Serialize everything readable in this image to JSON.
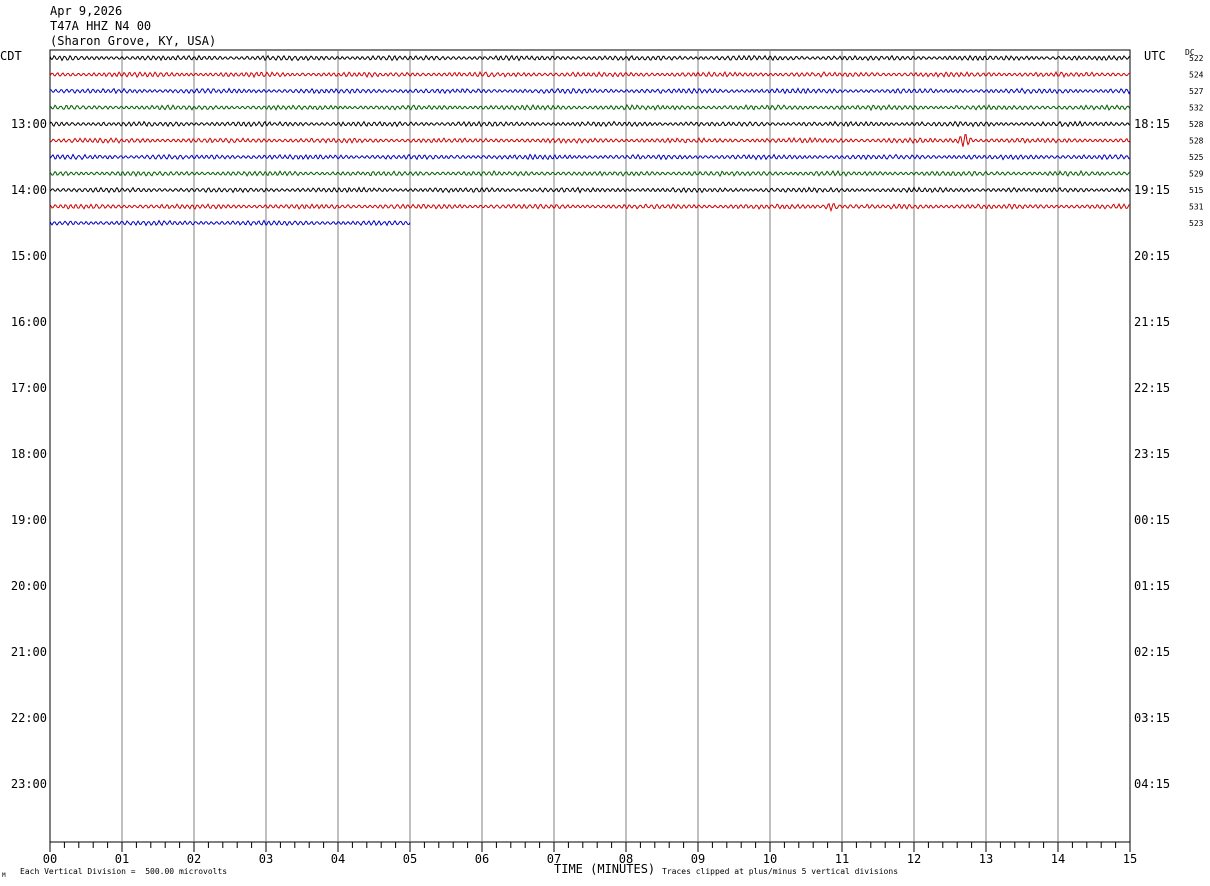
{
  "header": {
    "date": "Apr 9,2026",
    "station": "T47A HHZ N4 00",
    "location": "(Sharon Grove, KY, USA)"
  },
  "timezones": {
    "left": "CDT",
    "right": "UTC",
    "dc": "DC"
  },
  "footer": {
    "division": "Each Vertical Division =  500.00 microvolts",
    "xlabel": "TIME (MINUTES)",
    "clip": "Traces clipped at plus/minus 5 vertical divisions",
    "mark": "M"
  },
  "colors": {
    "cycle": [
      "#000000",
      "#d00000",
      "#0000c0",
      "#006000"
    ],
    "grid": "#808080"
  },
  "chart_data": {
    "type": "line",
    "title": "",
    "xlabel": "TIME (MINUTES)",
    "xlim": [
      0,
      15
    ],
    "x_ticks": [
      "00",
      "01",
      "02",
      "03",
      "04",
      "05",
      "06",
      "07",
      "08",
      "09",
      "10",
      "11",
      "12",
      "13",
      "14",
      "15"
    ],
    "hour_labels_left": [
      "13:00",
      "14:00",
      "15:00",
      "16:00",
      "17:00",
      "18:00",
      "19:00",
      "20:00",
      "21:00",
      "22:00",
      "23:00"
    ],
    "hour_labels_right": [
      "18:15",
      "19:15",
      "20:15",
      "21:15",
      "22:15",
      "23:15",
      "00:15",
      "01:15",
      "02:15",
      "03:15",
      "04:15"
    ],
    "lines_per_hour": 4,
    "first_hour_line_offset": 4,
    "traces": [
      {
        "dc": "522",
        "end_minute": 15
      },
      {
        "dc": "524",
        "end_minute": 15
      },
      {
        "dc": "527",
        "end_minute": 15
      },
      {
        "dc": "532",
        "end_minute": 15
      },
      {
        "dc": "528",
        "end_minute": 15
      },
      {
        "dc": "528",
        "end_minute": 15
      },
      {
        "dc": "525",
        "end_minute": 15
      },
      {
        "dc": "529",
        "end_minute": 15
      },
      {
        "dc": "515",
        "end_minute": 15
      },
      {
        "dc": "531",
        "end_minute": 15
      },
      {
        "dc": "523",
        "end_minute": 5
      }
    ],
    "events": [
      {
        "trace": 5,
        "minute": 12.7,
        "amplitude": "large"
      },
      {
        "trace": 9,
        "minute": 10.85,
        "amplitude": "medium"
      }
    ]
  }
}
